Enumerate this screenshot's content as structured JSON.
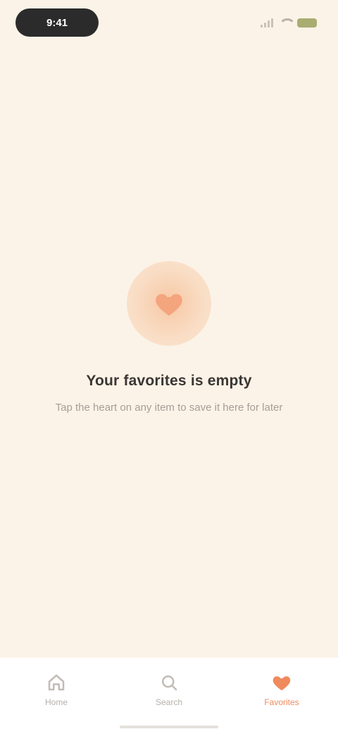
{
  "status_bar": {
    "time": "9:41",
    "battery": "",
    "icons": [
      "signal-icon",
      "wifi-icon",
      "battery-icon"
    ]
  },
  "empty_state": {
    "icon": "heart-icon",
    "title": "Your favorites is empty",
    "subtitle": "Tap the heart on any item to save it here for later"
  },
  "bottom_nav": {
    "items": [
      {
        "icon": "home-icon",
        "label": "Home",
        "active": false
      },
      {
        "icon": "search-icon",
        "label": "Search",
        "active": false
      },
      {
        "icon": "heart-icon",
        "label": "Favorites",
        "active": true
      }
    ]
  },
  "colors": {
    "background": "#fcf3e8",
    "accent": "#f08a5d",
    "text_primary": "#3a3633",
    "text_secondary": "#a59e97"
  }
}
